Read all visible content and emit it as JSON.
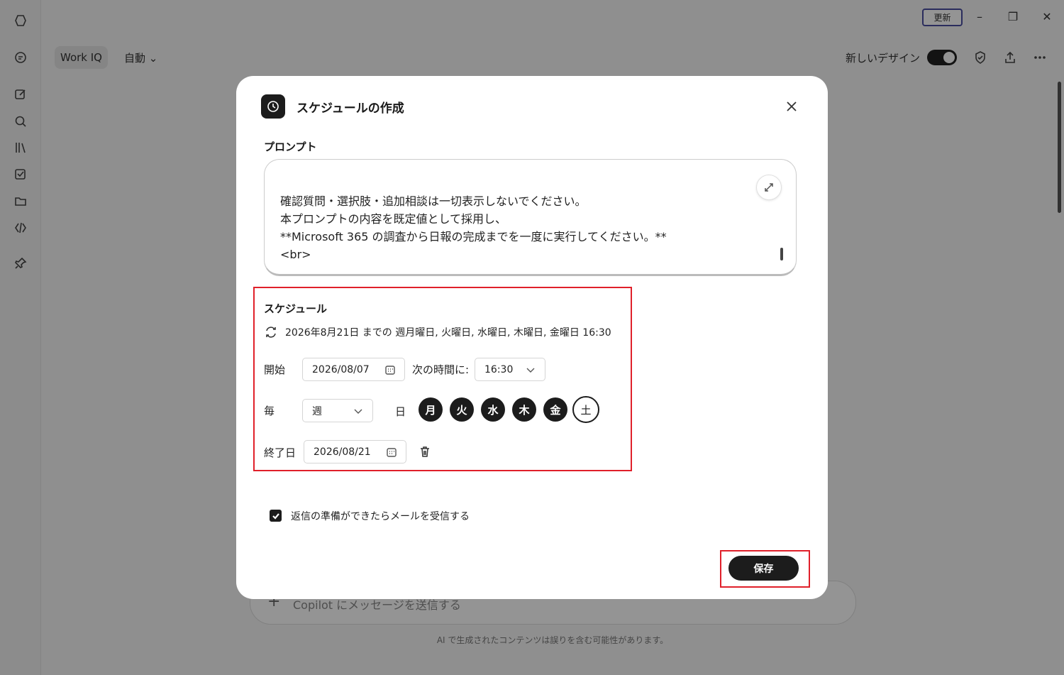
{
  "app": {
    "mode_chip": "Work IQ",
    "auto_dropdown": "自動",
    "update_button": "更新",
    "new_design_label": "新しいデザイン",
    "composer_placeholder": "Copilot にメッセージを送信する",
    "disclaimer": "AI で生成されたコンテンツは誤りを含む可能性があります。"
  },
  "dialog": {
    "title": "スケジュールの作成",
    "prompt_label": "プロンプト",
    "prompt_text": "確認質問・選択肢・追加相談は一切表示しないでください。\n本プロンプトの内容を既定値として採用し、\n**Microsoft 365 の調査から日報の完成までを一度に実行してください。**\n<br>",
    "schedule_label": "スケジュール",
    "schedule_summary": "2026年8月21日 までの 週月曜日, 火曜日, 水曜日, 木曜日, 金曜日 16:30",
    "start_label": "開始",
    "start_date": "2026/08/07",
    "time_label": "次の時間に:",
    "time_value": "16:30",
    "every_label": "毎",
    "frequency_value": "週",
    "day_label": "日",
    "days": [
      {
        "label": "月",
        "selected": true
      },
      {
        "label": "火",
        "selected": true
      },
      {
        "label": "水",
        "selected": true
      },
      {
        "label": "木",
        "selected": true
      },
      {
        "label": "金",
        "selected": true
      },
      {
        "label": "土",
        "selected": false
      }
    ],
    "end_label": "終了日",
    "end_date": "2026/08/21",
    "email_checkbox_label": "返信の準備ができたらメールを受信する",
    "email_checked": true,
    "save_button": "保存"
  },
  "colors": {
    "highlight": "#e0202a",
    "primary": "#1c1c1c"
  }
}
